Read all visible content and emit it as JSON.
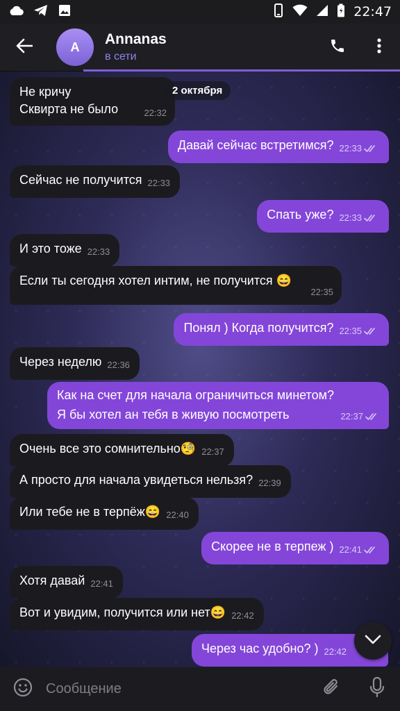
{
  "status_bar": {
    "time": "22:47"
  },
  "header": {
    "avatar_letter": "A",
    "name": "Annanas",
    "status": "в сети"
  },
  "date_label": "2 октября",
  "messages": [
    {
      "dir": "in",
      "text": "Не кричу\nСквирта не было",
      "time": "22:32"
    },
    {
      "dir": "out",
      "text": "Давай сейчас встретимся?",
      "time": "22:33",
      "read": true
    },
    {
      "dir": "in",
      "text": "Сейчас не получится",
      "time": "22:33"
    },
    {
      "dir": "out",
      "text": "Спать уже?",
      "time": "22:33",
      "read": true
    },
    {
      "dir": "in",
      "text": "И это тоже",
      "time": "22:33"
    },
    {
      "dir": "in",
      "text": "Если ты  сегодня хотел интим, не получится 😄",
      "time": "22:35"
    },
    {
      "dir": "out",
      "text": "Понял ) Когда получится?",
      "time": "22:35",
      "read": true
    },
    {
      "dir": "in",
      "text": "Через неделю",
      "time": "22:36"
    },
    {
      "dir": "out",
      "text": "Как на счет для начала ограничиться минетом?\nЯ бы хотел ан тебя в живую посмотреть",
      "time": "22:37",
      "read": true
    },
    {
      "dir": "in",
      "text": "Очень все это сомнительно🧐",
      "time": "22:37"
    },
    {
      "dir": "in",
      "text": "А просто для начала увидеться нельзя?",
      "time": "22:39"
    },
    {
      "dir": "in",
      "text": "Или тебе не в терпёж😄",
      "time": "22:40"
    },
    {
      "dir": "out",
      "text": "Скорее не в терпеж )",
      "time": "22:41",
      "read": true
    },
    {
      "dir": "in",
      "text": "Хотя давай",
      "time": "22:41"
    },
    {
      "dir": "in",
      "text": "Вот и увидим, получится или нет😄",
      "time": "22:42"
    },
    {
      "dir": "out",
      "text": "Через час удобно? )",
      "time": "22:42",
      "read": true
    }
  ],
  "composer": {
    "placeholder": "Сообщение"
  },
  "colors": {
    "accent": "#8446d9",
    "incoming": "#1b1b1f",
    "online": "#8d83e8",
    "bar": "#1f1f23"
  },
  "icons": {
    "status_left": [
      "cloud-icon",
      "telegram-icon",
      "image-icon"
    ],
    "status_right": [
      "vibrate-icon",
      "wifi-icon",
      "signal-icon",
      "battery-icon"
    ],
    "header": [
      "back-arrow-icon",
      "phone-icon",
      "more-vert-icon"
    ],
    "composer": [
      "emoji-icon",
      "attach-icon",
      "mic-icon"
    ],
    "scroll": "chevron-down-icon"
  }
}
